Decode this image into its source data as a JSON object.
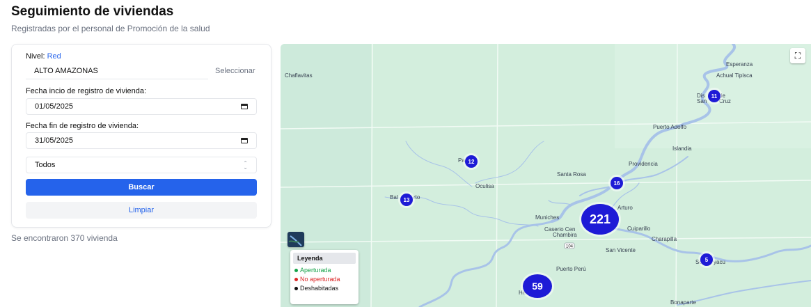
{
  "header": {
    "title": "Seguimiento de viviendas",
    "subtitle": "Registradas por el personal de Promoción de la salud"
  },
  "form": {
    "nivel_label": "Nivel:",
    "nivel_value": "Red",
    "red_value": "ALTO AMAZONAS",
    "select_link": "Seleccionar",
    "fecha_inicio_label": "Fecha incio de registro de vivienda:",
    "fecha_inicio_value": "01/05/2025",
    "fecha_fin_label": "Fecha fin de registro de vivienda:",
    "fecha_fin_value": "31/05/2025",
    "estado_selected": "Todos",
    "buscar_label": "Buscar",
    "limpiar_label": "Limpiar"
  },
  "results": {
    "count_text": "Se encontraron 370 vivienda"
  },
  "map": {
    "places": [
      "Chaflavitas",
      "Esperanza",
      "Achual Tipisca",
      "Dis",
      "de",
      "San",
      "Cruz",
      "Puerto Adolfo",
      "Islandia",
      "Providencia",
      "Santa Rosa",
      "Oculisa",
      "Pa",
      "Bal",
      "rto",
      "Arturo",
      "Muniches",
      "Caserio Cen",
      "Chambira",
      "Cuiparillo",
      "Charapilla",
      "San Vicente",
      "Schu",
      "yacu",
      "Puerto Perú",
      "He",
      "Bonaparte",
      "104"
    ],
    "clusters": [
      {
        "count": "11"
      },
      {
        "count": "12"
      },
      {
        "count": "16"
      },
      {
        "count": "13"
      },
      {
        "count": "221"
      },
      {
        "count": "5"
      },
      {
        "count": "59"
      }
    ],
    "fullscreen_icon": "fullscreen-icon",
    "layer_icon": "map-layer-icon"
  },
  "legend": {
    "title": "Leyenda",
    "items": [
      {
        "label": "Aperturada",
        "color": "#16a34a"
      },
      {
        "label": "No aperturada",
        "color": "#dc2626"
      },
      {
        "label": "Deshabitadas",
        "color": "#111111"
      }
    ]
  },
  "colors": {
    "accent": "#2563eb",
    "cluster": "#1e1bd6",
    "map_bg": "#d3eedd",
    "river": "#a8c3e8"
  }
}
